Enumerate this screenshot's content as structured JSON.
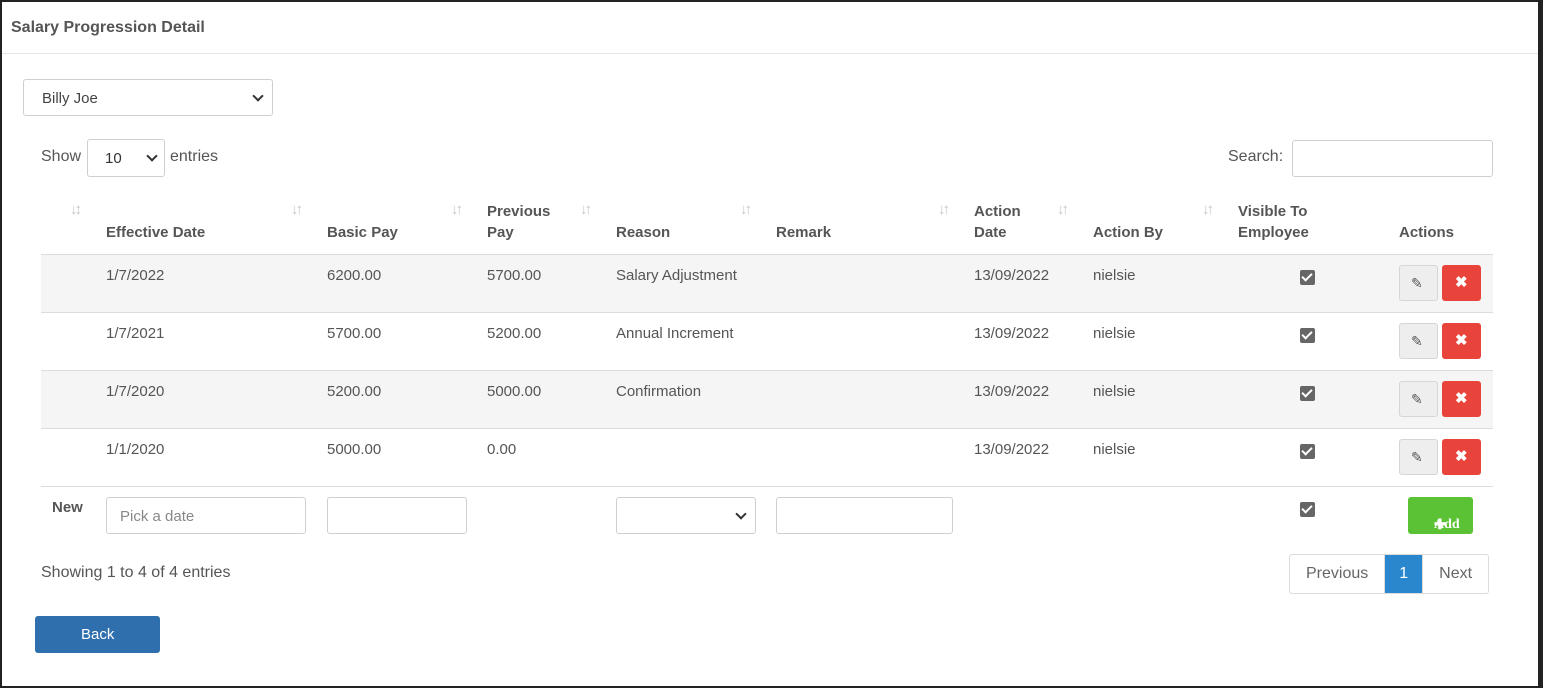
{
  "panel": {
    "title": "Salary Progression Detail"
  },
  "employee_select": {
    "value": "Billy Joe"
  },
  "length": {
    "show_label": "Show",
    "value": "10",
    "entries_label": "entries"
  },
  "search": {
    "label": "Search:",
    "value": ""
  },
  "columns": {
    "effective_date": "Effective Date",
    "basic_pay": "Basic Pay",
    "previous_pay_1": "Previous",
    "previous_pay_2": "Pay",
    "reason": "Reason",
    "remark": "Remark",
    "action_date_1": "Action",
    "action_date_2": "Date",
    "action_by": "Action By",
    "visible_1": "Visible To",
    "visible_2": "Employee",
    "actions": "Actions"
  },
  "rows": [
    {
      "effective_date": "1/7/2022",
      "basic_pay": "6200.00",
      "previous_pay": "5700.00",
      "reason": "Salary Adjustment",
      "remark": "",
      "action_date": "13/09/2022",
      "action_by": "nielsie",
      "visible": true
    },
    {
      "effective_date": "1/7/2021",
      "basic_pay": "5700.00",
      "previous_pay": "5200.00",
      "reason": "Annual Increment",
      "remark": "",
      "action_date": "13/09/2022",
      "action_by": "nielsie",
      "visible": true
    },
    {
      "effective_date": "1/7/2020",
      "basic_pay": "5200.00",
      "previous_pay": "5000.00",
      "reason": "Confirmation",
      "remark": "",
      "action_date": "13/09/2022",
      "action_by": "nielsie",
      "visible": true
    },
    {
      "effective_date": "1/1/2020",
      "basic_pay": "5000.00",
      "previous_pay": "0.00",
      "reason": "",
      "remark": "",
      "action_date": "13/09/2022",
      "action_by": "nielsie",
      "visible": true
    }
  ],
  "new_row": {
    "label": "New",
    "date_placeholder": "Pick a date",
    "basic_pay": "",
    "reason": "",
    "remark": "",
    "visible": true,
    "add_label": "Add"
  },
  "info": "Showing 1 to 4 of 4 entries",
  "pagination": {
    "previous": "Previous",
    "current": "1",
    "next": "Next"
  },
  "back_label": "Back",
  "icons": {
    "edit": "pencil-icon",
    "delete": "times-icon",
    "add": "plus-icon",
    "sort": "sort-icon"
  },
  "colors": {
    "delete": "#e9443b",
    "add": "#5bc236",
    "back": "#2f6fad",
    "page_active": "#2a86cd"
  }
}
